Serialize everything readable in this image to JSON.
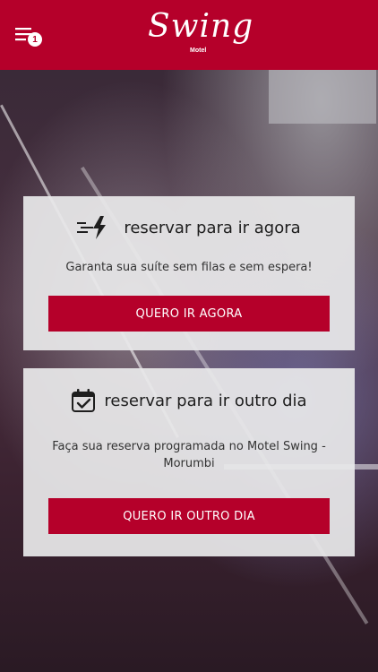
{
  "header": {
    "logo_text": "Swing",
    "logo_sub": "Motel",
    "menu_badge": "1",
    "brand_color": "#b5002a"
  },
  "cards": [
    {
      "icon": "fast-lightning-icon",
      "title": "reservar para ir agora",
      "description": "Garanta sua suíte sem filas e sem espera!",
      "button_label": "QUERO IR AGORA"
    },
    {
      "icon": "calendar-check-icon",
      "title": "reservar para ir outro dia",
      "description": "Faça sua reserva programada no Motel Swing - Morumbi",
      "button_label": "QUERO IR OUTRO DIA"
    }
  ]
}
